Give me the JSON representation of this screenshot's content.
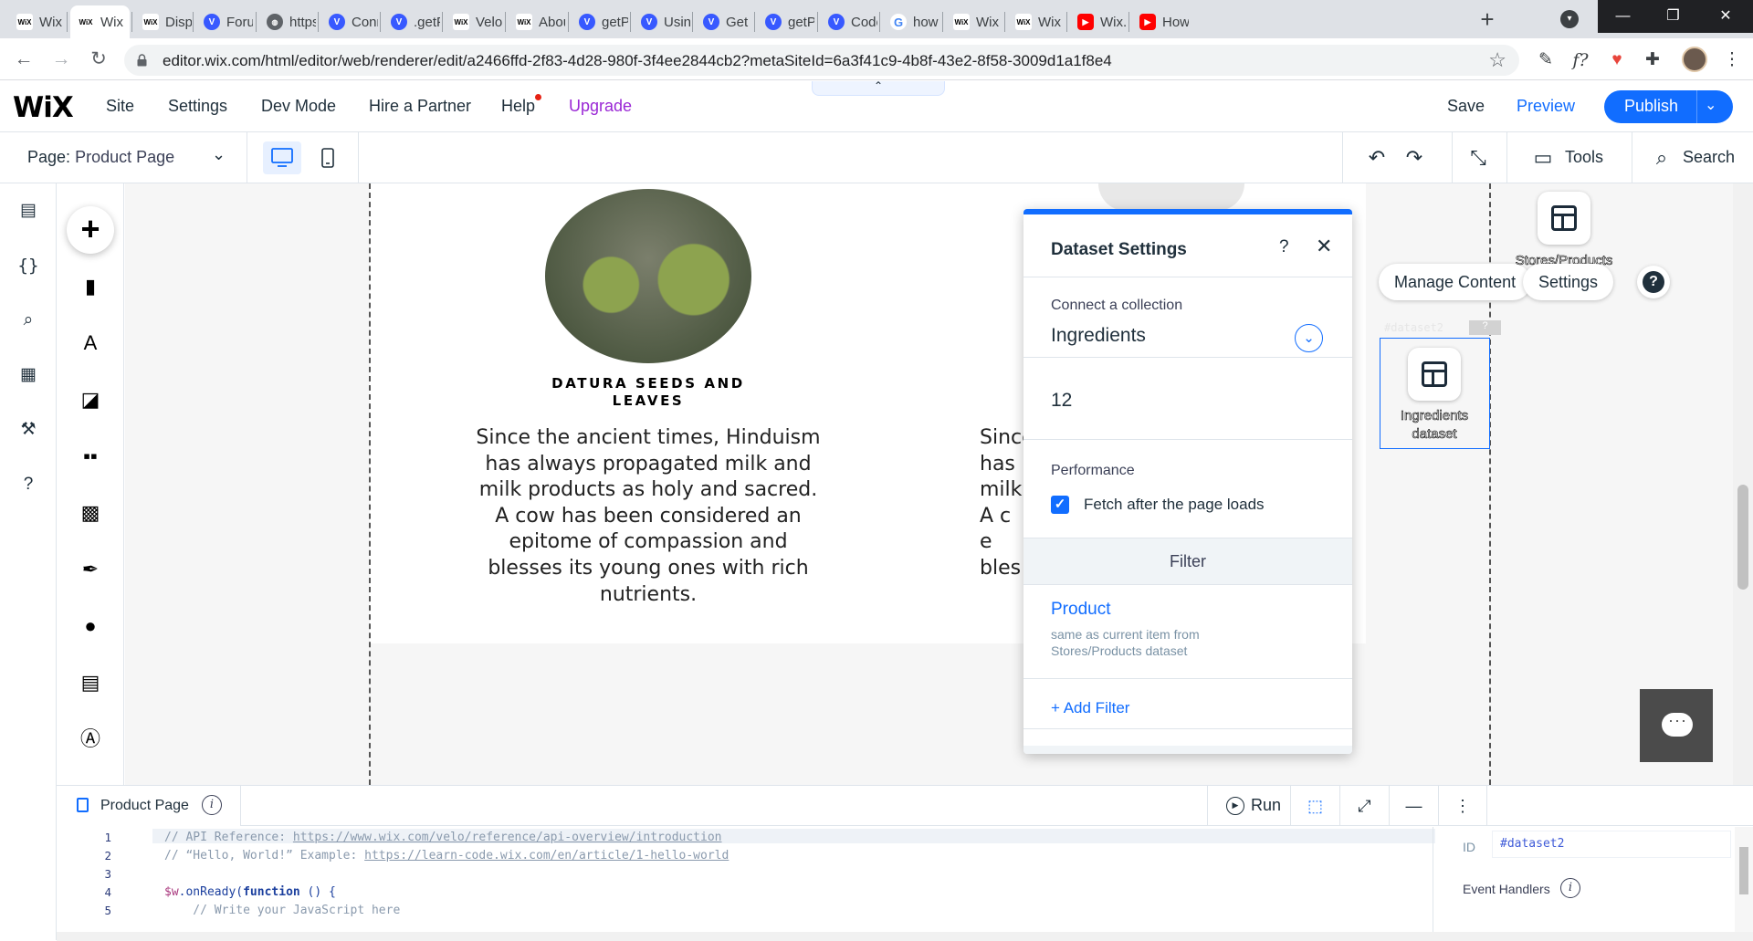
{
  "browser": {
    "tabs": [
      {
        "label": "Wix",
        "favicon": "wix"
      },
      {
        "label": "Wix",
        "favicon": "wix",
        "active": true
      },
      {
        "label": "Displ",
        "favicon": "wix"
      },
      {
        "label": "Forur",
        "favicon": "velo"
      },
      {
        "label": "https",
        "favicon": "globe"
      },
      {
        "label": "Conn",
        "favicon": "velo"
      },
      {
        "label": ".getP",
        "favicon": "velo"
      },
      {
        "label": "Velo",
        "favicon": "wix"
      },
      {
        "label": "Abou",
        "favicon": "wix"
      },
      {
        "label": "getPr",
        "favicon": "velo"
      },
      {
        "label": "Using",
        "favicon": "velo"
      },
      {
        "label": "Get p",
        "favicon": "velo"
      },
      {
        "label": "getPr",
        "favicon": "velo"
      },
      {
        "label": "Code",
        "favicon": "velo"
      },
      {
        "label": "how",
        "favicon": "google"
      },
      {
        "label": "Wix",
        "favicon": "wix"
      },
      {
        "label": "Wix",
        "favicon": "wix"
      },
      {
        "label": "Wix.c",
        "favicon": "youtube"
      },
      {
        "label": "How",
        "favicon": "youtube"
      }
    ],
    "url": "editor.wix.com/html/editor/web/renderer/edit/a2466ffd-2f83-4d28-980f-3f4ee2844cb2?metaSiteId=6a3f41c9-4b8f-43e2-8f58-3009d1a1f8e4",
    "ext_f": "f?"
  },
  "wix_topbar": {
    "logo": "WiX",
    "menu": [
      "Site",
      "Settings",
      "Dev Mode",
      "Hire a Partner",
      "Help",
      "Upgrade"
    ],
    "save": "Save",
    "preview": "Preview",
    "publish": "Publish",
    "accent": "#116dff"
  },
  "pagebar": {
    "page_prefix": "Page:",
    "page_name": "Product Page",
    "tools": "Tools",
    "search": "Search"
  },
  "canvas": {
    "product_title": "DATURA SEEDS AND LEAVES",
    "product_desc": "Since the ancient times, Hinduism has always propagated milk and milk products as holy and sacred. A cow has been considered an epitome of compassion and blesses its young ones with rich nutrients.",
    "product_desc_partial": "Since\nhas\nmilk\nA c\ne\nbles",
    "dataset1_label": "Stores/Products",
    "dataset2_tag": "#dataset2",
    "dataset2_label": "Ingredients dataset",
    "manage_content": "Manage Content",
    "settings": "Settings",
    "help": "?"
  },
  "dataset_panel": {
    "title": "Dataset Settings",
    "connect_label": "Connect a collection",
    "collection": "Ingredients",
    "items_value": "12",
    "performance_label": "Performance",
    "fetch_after_load": "Fetch after the page loads",
    "fetch_checked": true,
    "filter_header": "Filter",
    "filter_field": "Product",
    "filter_desc": "same as current item from Stores/Products dataset",
    "add_filter": "+ Add Filter"
  },
  "code_panel": {
    "tab_label": "Product Page",
    "run": "Run",
    "line_numbers": [
      "1",
      "2",
      "3",
      "4",
      "5"
    ],
    "line1_prefix": "// API Reference: ",
    "line1_link": "https://www.wix.com/velo/reference/api-overview/introduction",
    "line2_prefix": "// “Hello, World!” Example: ",
    "line2_link": "https://learn-code.wix.com/en/article/1-hello-world",
    "line4_obj": "$w",
    "line4_method": ".onReady(",
    "line4_kw": "function",
    "line4_rest": " () {",
    "line5": "    // Write your JavaScript here",
    "id_label": "ID",
    "id_value": "#dataset2",
    "event_handlers": "Event Handlers"
  }
}
